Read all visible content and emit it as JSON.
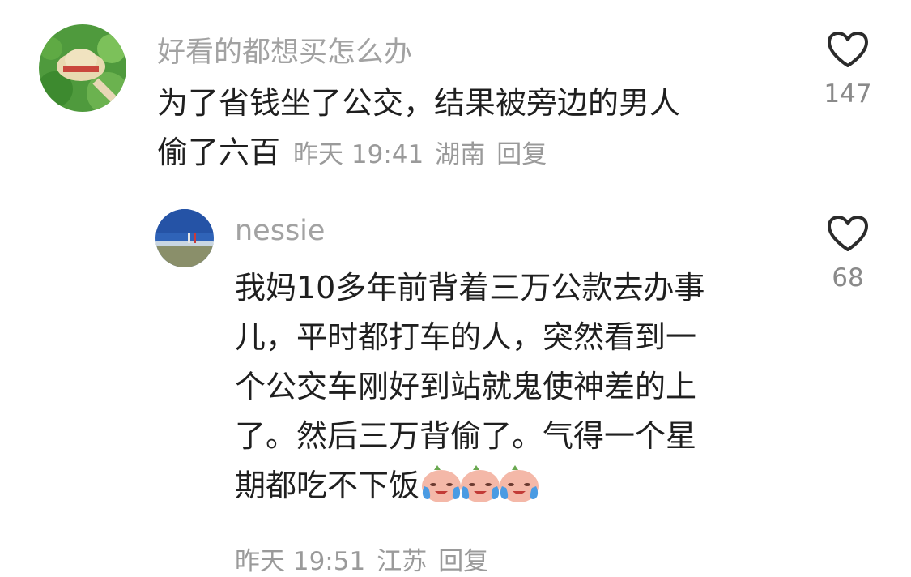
{
  "comments": [
    {
      "username": "好看的都想买怎么办",
      "lines": [
        "为了省钱坐了公交，结果被旁边的男人",
        "偷了六百"
      ],
      "time": "昨天 19:41",
      "location": "湖南",
      "reply_label": "回复",
      "like_count": "147",
      "avatar_icon": "straw-hat-avatar"
    },
    {
      "username": "nessie",
      "lines": [
        "我妈10多年前背着三万公款去办事",
        "儿，平时都打车的人，突然看到一",
        "个公交车刚好到站就鬼使神差的上",
        "了。然后三万背偷了。气得一个星",
        "期都吃不下饭"
      ],
      "emoji": [
        "crying-face-emoji",
        "crying-face-emoji",
        "crying-face-emoji"
      ],
      "time": "昨天 19:51",
      "location": "江苏",
      "reply_label": "回复",
      "like_count": "68",
      "avatar_icon": "landscape-avatar"
    }
  ],
  "colors": {
    "username": "#a2a2a2",
    "text": "#1f1f1f",
    "meta": "#9a9a9a",
    "heart_outline": "#2b2b2b"
  }
}
